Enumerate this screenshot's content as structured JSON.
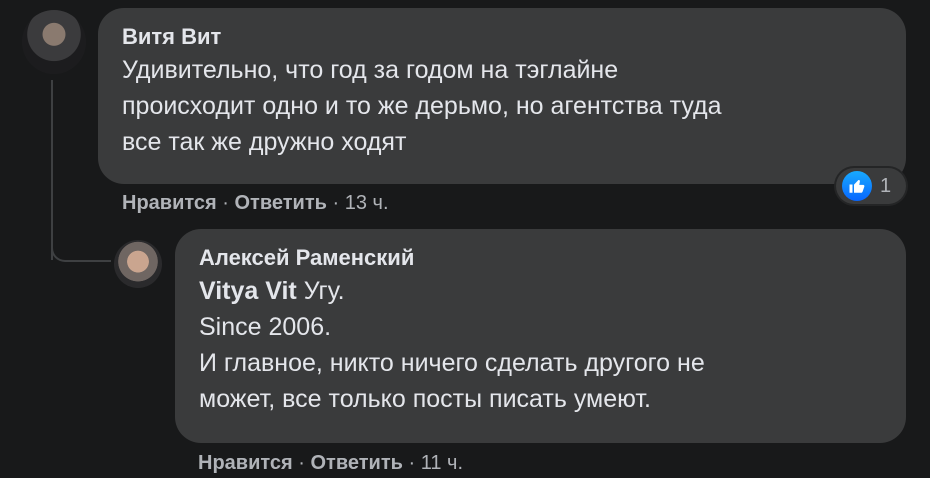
{
  "comment": {
    "author": "Витя Вит",
    "text": "Удивительно, что год за годом на тэглайне\nпроисходит одно и то же дерьмо, но агентства туда\nвсе так же дружно ходят",
    "like_label": "Нравится",
    "reply_label": "Ответить",
    "separator": "·",
    "time": "13 ч.",
    "reactions": {
      "icon": "like-icon",
      "count": "1",
      "color": "#0866ff"
    }
  },
  "reply": {
    "author": "Алексей Раменский",
    "mention": "Vitya Vit",
    "text_first": " Угу.",
    "text_rest": "Since 2006.\nИ главное, никто ничего сделать другого не\nможет, все только посты писать умеют.",
    "like_label": "Нравится",
    "reply_label": "Ответить",
    "separator": "·",
    "time": "11 ч."
  }
}
